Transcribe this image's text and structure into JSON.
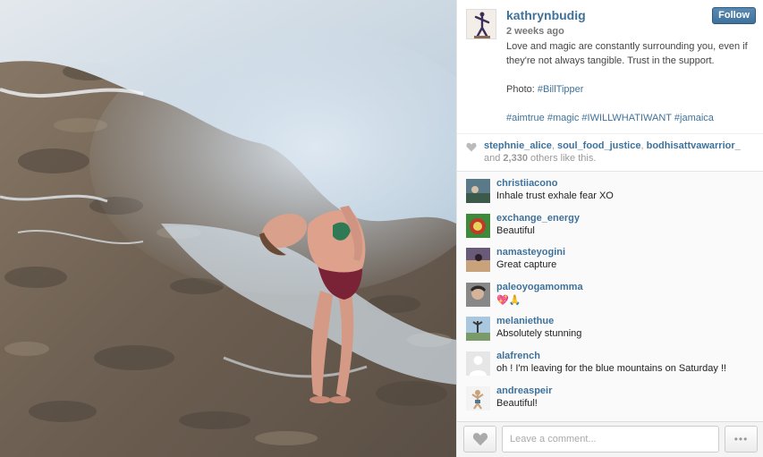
{
  "post": {
    "owner": "kathrynbudig",
    "follow_label": "Follow",
    "time_ago": "2 weeks ago",
    "caption_line1": "Love and magic are constantly surrounding you, even if they're not always tangible. Trust in the support.",
    "caption_photo": "Photo: ",
    "caption_photo_tag": "#BillTipper",
    "hashtags": [
      "#aimtrue",
      "#magic",
      "#IWILLWHATIWANT",
      "#jamaica"
    ]
  },
  "likes": {
    "users": [
      "stephnie_alice",
      "soul_food_justice",
      "bodhisattvawarrior_"
    ],
    "and_text": "and ",
    "count": "2,330",
    "others_text": " others like this."
  },
  "comments": [
    {
      "user": "christiiacono",
      "text": "Inhale trust exhale fear XO"
    },
    {
      "user": "exchange_energy",
      "text": "Beautiful"
    },
    {
      "user": "namasteyogini",
      "text": "Great capture"
    },
    {
      "user": "paleoyogamomma",
      "text": "💖🙏"
    },
    {
      "user": "melaniethue",
      "text": "Absolutely stunning"
    },
    {
      "user": "alafrench",
      "text": "oh ! I'm leaving for the blue mountains on Saturday !!"
    },
    {
      "user": "andreaspeir",
      "text": "Beautiful!"
    }
  ],
  "footer": {
    "comment_placeholder": "Leave a comment...",
    "more_label": "•••"
  },
  "colors": {
    "link": "#3f729b",
    "follow_bg": "#3f729b"
  }
}
